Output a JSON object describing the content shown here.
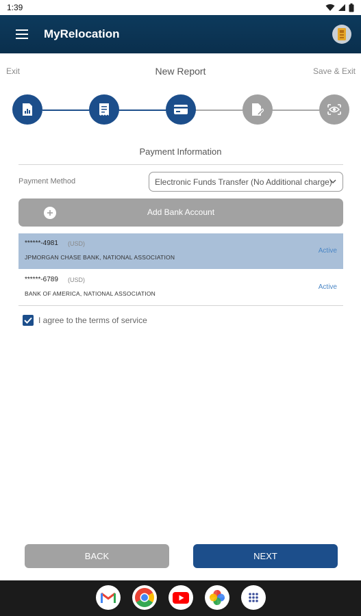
{
  "status_bar": {
    "time": "1:39"
  },
  "app_bar": {
    "title": "MyRelocation"
  },
  "report_header": {
    "exit_label": "Exit",
    "title": "New Report",
    "save_exit_label": "Save & Exit"
  },
  "stepper": {
    "total_steps": 5,
    "completed_steps": 3,
    "steps": [
      {
        "icon": "document-chart-icon",
        "state": "done"
      },
      {
        "icon": "receipt-icon",
        "state": "done"
      },
      {
        "icon": "credit-card-icon",
        "state": "done"
      },
      {
        "icon": "document-pen-icon",
        "state": "todo"
      },
      {
        "icon": "eye-review-icon",
        "state": "todo"
      }
    ]
  },
  "payment": {
    "section_title": "Payment Information",
    "method_label": "Payment Method",
    "method_value": "Electronic Funds Transfer (No Additional charge)",
    "add_bank_label": "Add Bank Account"
  },
  "accounts": [
    {
      "number": "******-4981",
      "currency": "(USD)",
      "bank": "JPMORGAN CHASE BANK, NATIONAL ASSOCIATION",
      "status": "Active",
      "selected": true
    },
    {
      "number": "******-6789",
      "currency": "(USD)",
      "bank": "BANK OF AMERICA, NATIONAL ASSOCIATION",
      "status": "Active",
      "selected": false
    }
  ],
  "terms": {
    "label": "I agree to the terms of service",
    "checked": true
  },
  "buttons": {
    "back_label": "BACK",
    "next_label": "NEXT"
  },
  "dock": {
    "apps": [
      "gmail-icon",
      "chrome-icon",
      "youtube-icon",
      "photos-icon",
      "app-drawer-icon"
    ]
  },
  "colors": {
    "primary": "#1c4e8b",
    "app_bar": "#0d3a5c",
    "selected_row": "#a9bfd8",
    "disabled": "#a2a2a2",
    "link": "#4a86c5"
  }
}
